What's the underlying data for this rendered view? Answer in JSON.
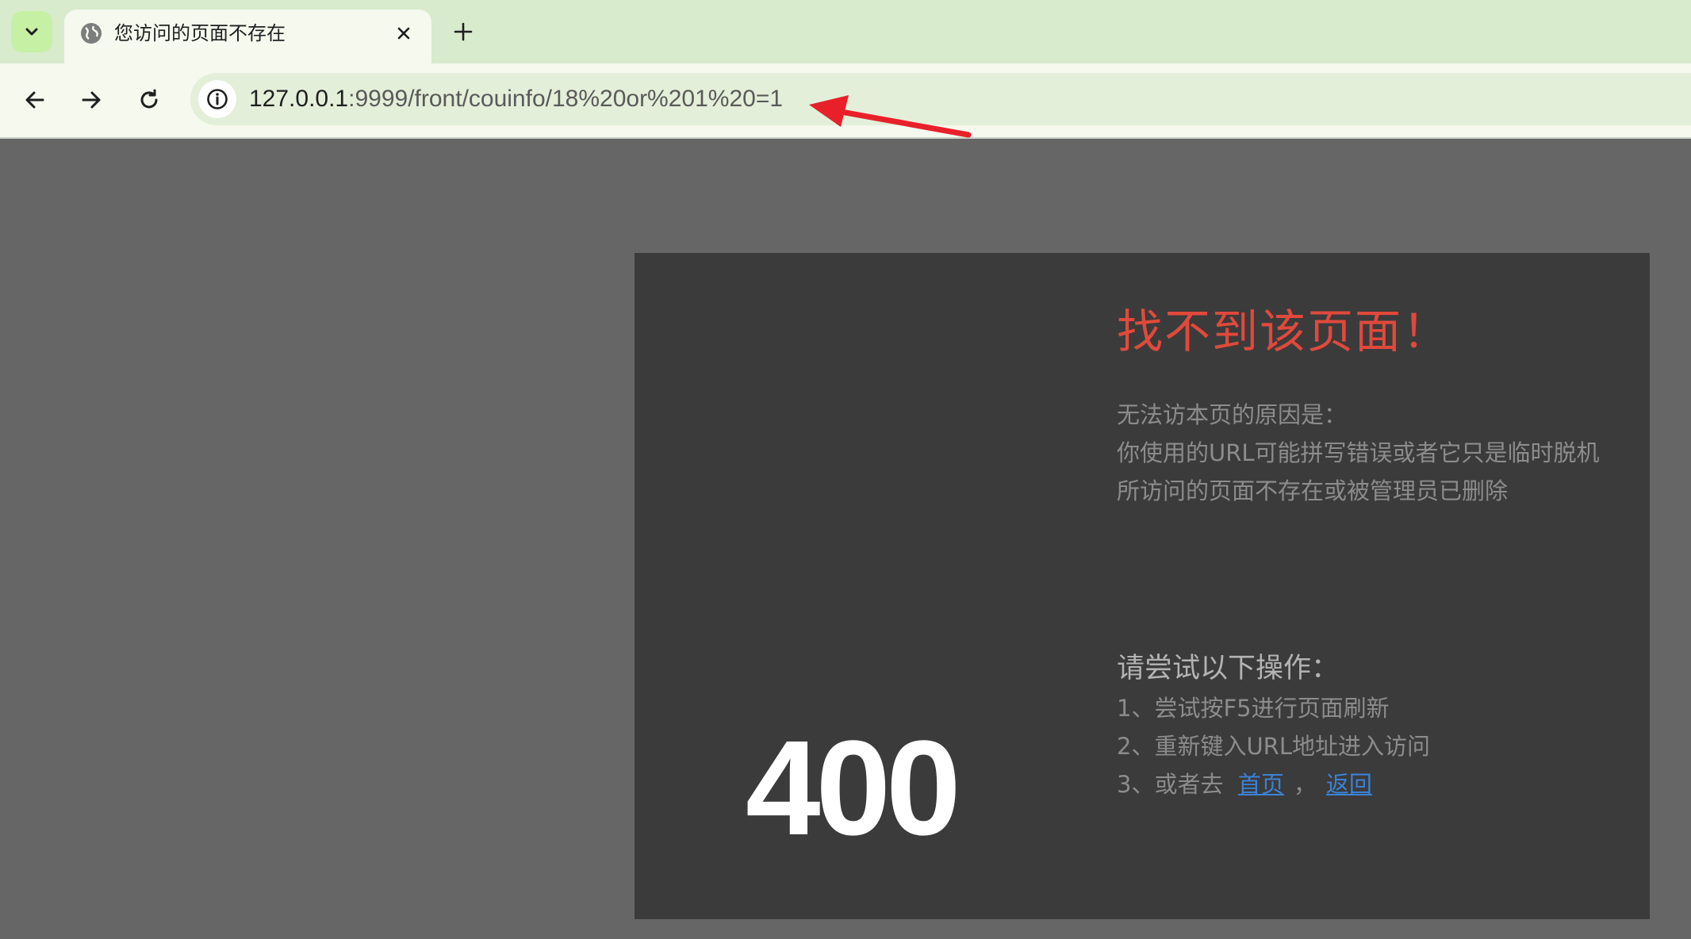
{
  "browser": {
    "tab": {
      "title": "您访问的页面不存在"
    },
    "address": {
      "host": "127.0.0.1",
      "rest": ":9999/front/couinfo/18%20or%201%20=1"
    }
  },
  "error_page": {
    "code": "400",
    "title": "找不到该页面！",
    "reasons": [
      "无法访本页的原因是：",
      "你使用的URL可能拼写错误或者它只是临时脱机",
      "所访问的页面不存在或被管理员已删除"
    ],
    "try_title": "请尝试以下操作：",
    "steps": [
      "1、尝试按F5进行页面刷新",
      "2、重新键入URL地址进入访问"
    ],
    "step3_prefix": "3、或者去",
    "link_home": "首页",
    "link_separator": "，",
    "link_back": "返回"
  },
  "colors": {
    "annotation_arrow": "#e8202a",
    "title_red": "#e0493b",
    "link_blue": "#3b82d6"
  },
  "icons": {
    "tab_search": "chevron-down-icon",
    "favicon": "globe-icon",
    "tab_close": "close-icon",
    "new_tab": "plus-icon",
    "back": "arrow-left-icon",
    "forward": "arrow-right-icon",
    "reload": "reload-icon",
    "site_info": "info-icon"
  }
}
